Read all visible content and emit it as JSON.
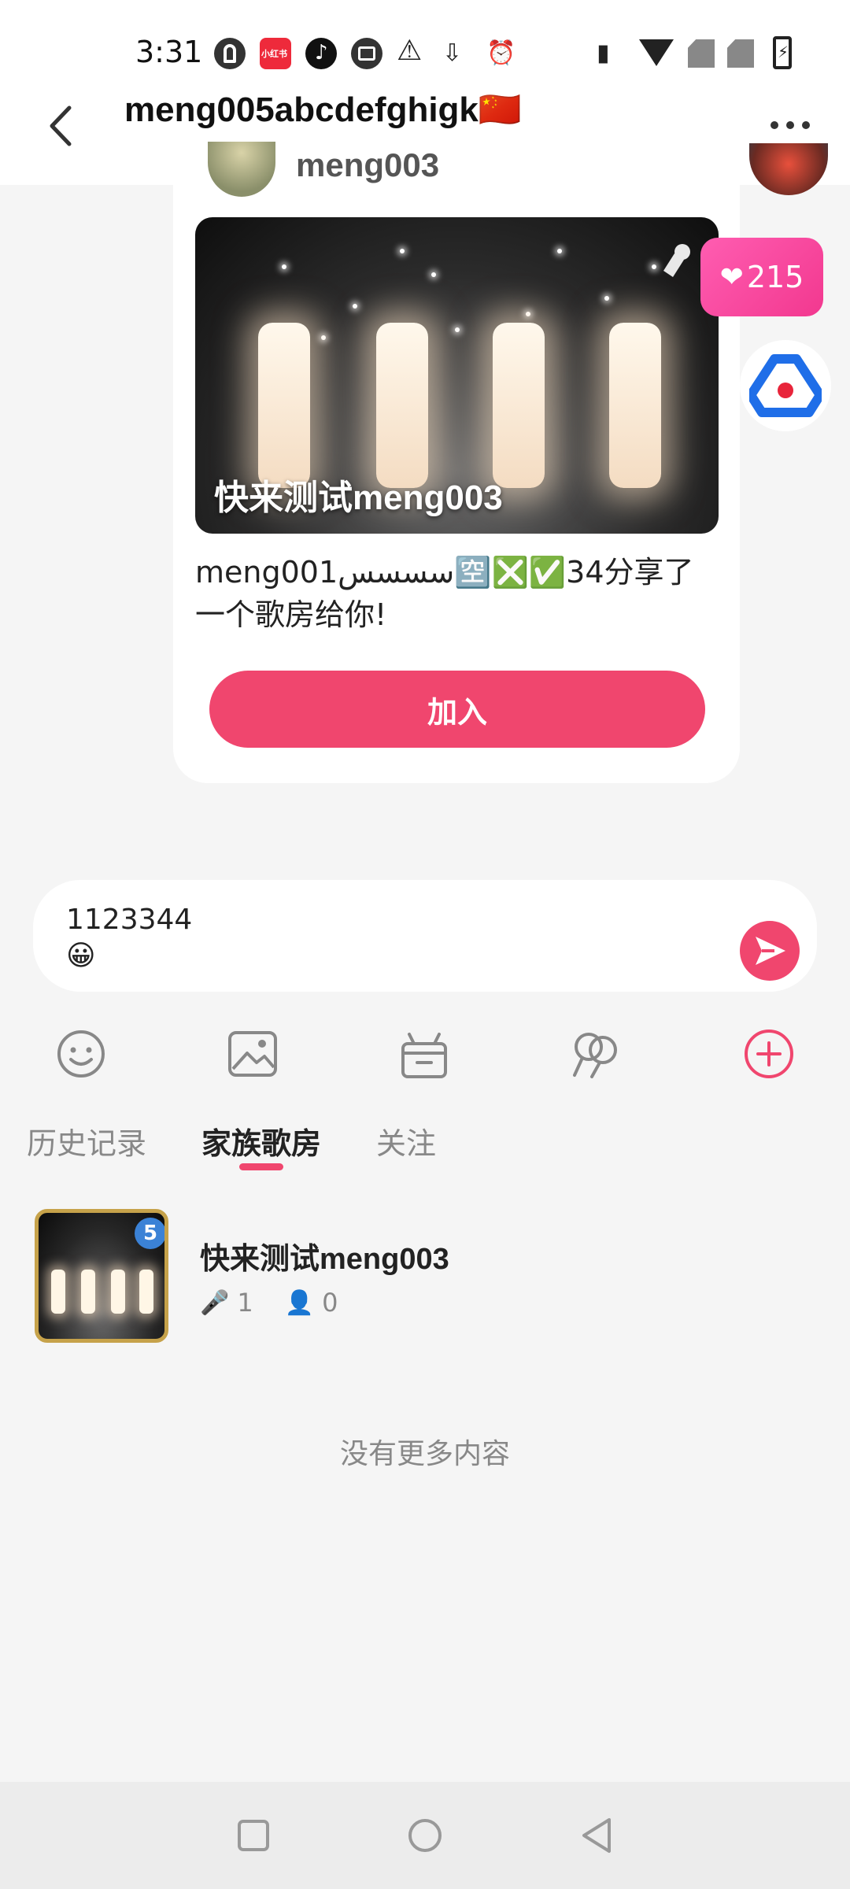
{
  "status_bar": {
    "time": "3:31",
    "app_icons": [
      "p-app-icon",
      "xiaohongshu-icon",
      "tiktok-icon",
      "wallet-icon",
      "warning-icon",
      "download-icon",
      "alarm-icon"
    ],
    "xiaohongshu_label": "小红书",
    "system_icons": [
      "vibrate-icon",
      "wifi-icon",
      "no-sim-icon",
      "no-sim-icon",
      "battery-charging-icon"
    ]
  },
  "header": {
    "title": "meng005abcdefghigk🇨🇳"
  },
  "message": {
    "sender_name": "meng003",
    "room_title": "快来测试meng003",
    "share_text": "meng001ﺳﺴﺴﺲ🈳❎✅34分享了一个歌房给你!",
    "join_label": "加入"
  },
  "likes": {
    "count": "215"
  },
  "input": {
    "value": "1123344\n😀"
  },
  "tabs": [
    {
      "label": "历史记录",
      "active": false
    },
    {
      "label": "家族歌房",
      "active": true
    },
    {
      "label": "关注",
      "active": false
    }
  ],
  "room_list": {
    "items": [
      {
        "name": "快来测试meng003",
        "singers": "1",
        "listeners": "0",
        "level": "5"
      }
    ],
    "empty_text": "没有更多内容"
  },
  "colors": {
    "accent": "#f0466e",
    "likes_gradient_start": "#ff5db1",
    "likes_gradient_end": "#f2388f",
    "brand_blue": "#1f6ee8"
  }
}
